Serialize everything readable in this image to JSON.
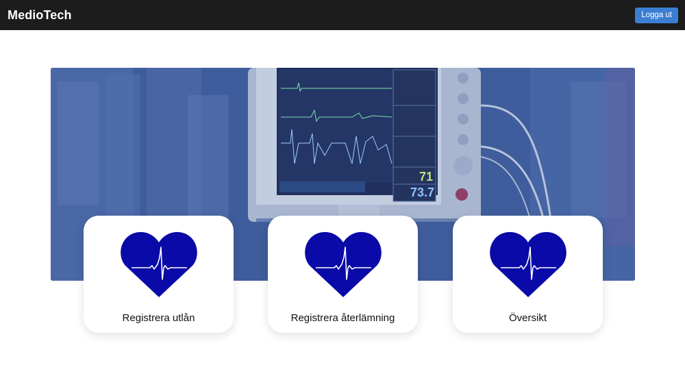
{
  "header": {
    "brand": "MedioTech",
    "logout_label": "Logga ut"
  },
  "hero": {
    "monitor_values": [
      "71",
      "73.7"
    ]
  },
  "cards": [
    {
      "label": "Registrera utlån",
      "icon": "heart-pulse-icon"
    },
    {
      "label": "Registrera återlämning",
      "icon": "heart-pulse-icon"
    },
    {
      "label": "Översikt",
      "icon": "heart-pulse-icon"
    }
  ],
  "colors": {
    "header_bg": "#1c1c1c",
    "accent": "#3b7fd4",
    "heart": "#0a0aa8",
    "hero_tint": "#3c5a98"
  }
}
